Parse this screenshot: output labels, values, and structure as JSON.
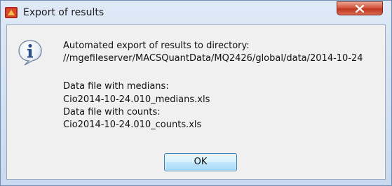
{
  "window": {
    "title": "Export of results"
  },
  "message": {
    "intro": "Automated export of results to directory:",
    "directory": "//mgefileserver/MACSQuantData/MQ2426/global/data/2014-10-24",
    "medians_label": "Data file with medians:",
    "medians_file": "Cio2014-10-24.010_medians.xls",
    "counts_label": "Data file with counts:",
    "counts_file": "Cio2014-10-24.010_counts.xls"
  },
  "buttons": {
    "ok_label": "OK"
  },
  "icons": {
    "app": "app-icon",
    "info": "info-icon",
    "close": "close-icon"
  }
}
